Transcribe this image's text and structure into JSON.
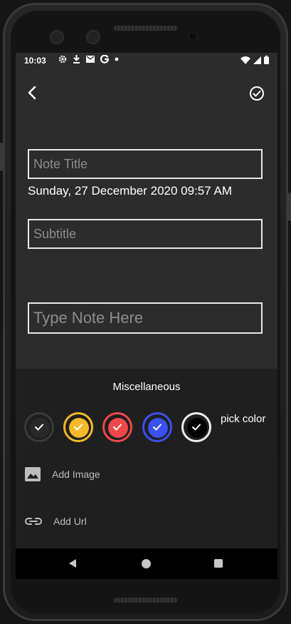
{
  "status_bar": {
    "time": "10:03",
    "icons": [
      "gear-icon",
      "download-icon",
      "mail-icon",
      "google-icon",
      "dot-icon"
    ],
    "right_icons": [
      "wifi-icon",
      "signal-icon",
      "battery-icon"
    ]
  },
  "header": {
    "back_icon": "chevron-left-icon",
    "save_icon": "check-circle-icon"
  },
  "note": {
    "title_placeholder": "Note Title",
    "datetime": "Sunday, 27 December 2020 09:57 AM",
    "subtitle_placeholder": "Subtitle",
    "body_placeholder": "Type Note Here"
  },
  "misc": {
    "title": "Miscellaneous",
    "colors": [
      {
        "name": "default",
        "fill": "#333333",
        "ring": "#3b3b3b",
        "selected": true
      },
      {
        "name": "yellow",
        "fill": "#f5b929",
        "ring": "#f5b929",
        "selected": false
      },
      {
        "name": "red",
        "fill": "#f04848",
        "ring": "#f04848",
        "selected": false
      },
      {
        "name": "blue",
        "fill": "#3a50f0",
        "ring": "#3a50f0",
        "selected": false
      },
      {
        "name": "black",
        "fill": "#000000",
        "ring": "#eeeeee",
        "selected": false
      }
    ],
    "pick_color_label": "pick color",
    "add_image_label": "Add Image",
    "add_url_label": "Add Url"
  },
  "navigation": {
    "items": [
      "back-nav-icon",
      "home-nav-icon",
      "recents-nav-icon"
    ]
  }
}
